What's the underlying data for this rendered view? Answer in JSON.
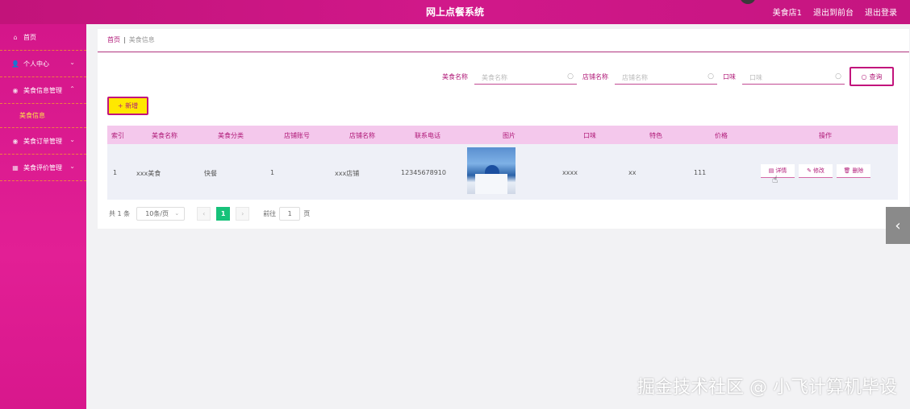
{
  "header": {
    "title": "网上点餐系统",
    "links": [
      "美食店1",
      "退出到前台",
      "退出登录"
    ]
  },
  "sidebar": {
    "items": [
      {
        "label": "首页",
        "icon": "home-icon"
      },
      {
        "label": "个人中心",
        "icon": "user-icon"
      },
      {
        "label": "美食信息管理",
        "icon": "info-icon"
      },
      {
        "label": "美食信息",
        "icon": ""
      },
      {
        "label": "美食订单管理",
        "icon": "order-icon"
      },
      {
        "label": "美食评价管理",
        "icon": "review-icon"
      }
    ]
  },
  "breadcrumb": {
    "home": "首页",
    "separator": "|",
    "current": "美食信息"
  },
  "search": {
    "fields": [
      {
        "label": "美食名称",
        "placeholder": "美食名称"
      },
      {
        "label": "店铺名称",
        "placeholder": "店铺名称"
      },
      {
        "label": "口味",
        "placeholder": "口味"
      }
    ],
    "query_label": "查询"
  },
  "toolbar": {
    "add_label": "+ 新增"
  },
  "table": {
    "columns": [
      "索引",
      "美食名称",
      "美食分类",
      "店铺账号",
      "店铺名称",
      "联系电话",
      "图片",
      "口味",
      "特色",
      "价格",
      "操作"
    ],
    "rows": [
      {
        "index": "1",
        "name": "xxx美食",
        "category": "快餐",
        "shop_account": "1",
        "shop_name": "xxx店铺",
        "phone": "12345678910",
        "taste": "xxxx",
        "feature": "xx",
        "price": "111"
      }
    ],
    "actions": {
      "detail": "详情",
      "edit": "修改",
      "delete": "删除"
    }
  },
  "pagination": {
    "total": "共 1 条",
    "page_size": "10条/页",
    "current_page": "1",
    "goto_label": "前往",
    "goto_value": "1",
    "page_suffix": "页"
  },
  "watermark": "掘金技术社区 @ 小飞计算机毕设",
  "colors": {
    "accent": "#c2147c",
    "sidebar": "#e21f95",
    "highlight": "#ffe800",
    "page_active": "#17c27a"
  }
}
